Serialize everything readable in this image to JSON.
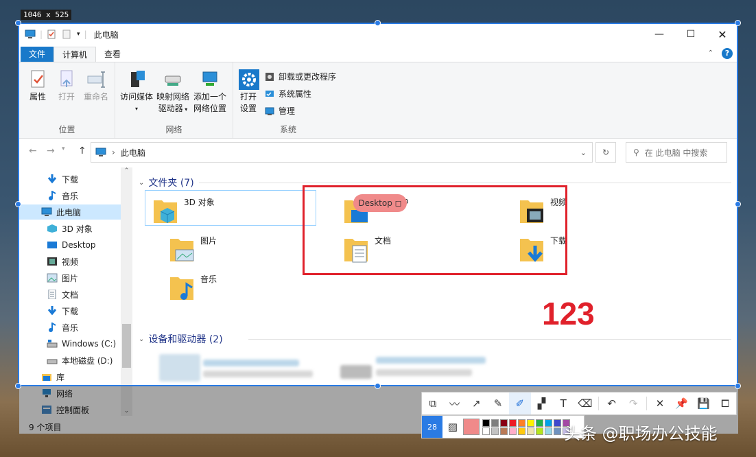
{
  "overlay": {
    "size_label": "1046 x 525",
    "annotation_number": "123",
    "watermark": "头条 @职场办公技能",
    "pen_size": "28"
  },
  "window": {
    "title": "此电脑",
    "min_icon": "minimize-icon",
    "max_icon": "maximize-icon",
    "close_icon": "close-icon"
  },
  "tabs": [
    "文件",
    "计算机",
    "查看"
  ],
  "ribbon": {
    "location": {
      "label": "位置",
      "properties": "属性",
      "open": "打开",
      "rename": "重命名"
    },
    "network": {
      "label": "网络",
      "media": "访问媒体",
      "map1": "映射网络",
      "map2": "驱动器",
      "add1": "添加一个",
      "add2": "网络位置"
    },
    "system": {
      "label": "系统",
      "open1": "打开",
      "open2": "设置",
      "uninstall": "卸载或更改程序",
      "sysprops": "系统属性",
      "manage": "管理"
    }
  },
  "address": {
    "path": "此电脑",
    "search_placeholder": "在 此电脑 中搜索"
  },
  "nav": [
    {
      "label": "下载"
    },
    {
      "label": "音乐"
    },
    {
      "label": "此电脑"
    },
    {
      "label": "3D 对象"
    },
    {
      "label": "Desktop"
    },
    {
      "label": "视频"
    },
    {
      "label": "图片"
    },
    {
      "label": "文档"
    },
    {
      "label": "下载"
    },
    {
      "label": "音乐"
    },
    {
      "label": "Windows (C:)"
    },
    {
      "label": "本地磁盘 (D:)"
    },
    {
      "label": "库"
    },
    {
      "label": "网络"
    },
    {
      "label": "控制面板"
    }
  ],
  "sections": {
    "folders": "文件夹 (7)",
    "devices": "设备和驱动器 (2)"
  },
  "folders": [
    {
      "label": "3D 对象"
    },
    {
      "label": "Desktop"
    },
    {
      "label": "视频"
    },
    {
      "label": "图片"
    },
    {
      "label": "文档"
    },
    {
      "label": "下载"
    },
    {
      "label": "音乐"
    }
  ],
  "status": {
    "count": "9 个项目"
  },
  "colors": {
    "accent": "#2a7be4",
    "annotation_red": "#e0212b",
    "file_tab": "#1979ca"
  },
  "palette": [
    "#000000",
    "#7f7f7f",
    "#880015",
    "#ed1c24",
    "#ff7f27",
    "#fff200",
    "#22b14c",
    "#00a2e8",
    "#3f48cc",
    "#a349a4",
    "#ffffff",
    "#c3c3c3",
    "#b97a57",
    "#ffaec9",
    "#ffc90e",
    "#efe4b0",
    "#b5e61d",
    "#99d9ea",
    "#7092be",
    "#c8bfe7"
  ]
}
